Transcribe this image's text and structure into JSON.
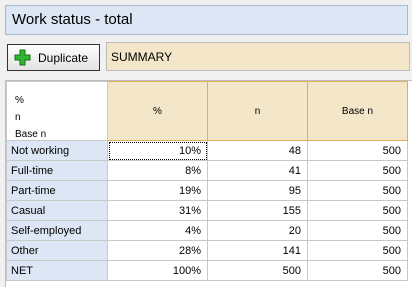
{
  "title": "Work status - total",
  "toolbar": {
    "duplicate_label": "Duplicate",
    "summary_value": "SUMMARY"
  },
  "icons": {
    "duplicate": "plus-icon"
  },
  "colors": {
    "plus": "#2fb62f",
    "header_fill": "#f3e6c9",
    "row_header_fill": "#dce6f4"
  },
  "table": {
    "corner_lines": [
      "%",
      "n",
      "Base n"
    ],
    "columns": [
      "%",
      "n",
      "Base n"
    ],
    "rows": [
      {
        "label": "Not working",
        "cells": [
          "10%",
          "48",
          "500"
        ]
      },
      {
        "label": "Full-time",
        "cells": [
          "8%",
          "41",
          "500"
        ]
      },
      {
        "label": "Part-time",
        "cells": [
          "19%",
          "95",
          "500"
        ]
      },
      {
        "label": "Casual",
        "cells": [
          "31%",
          "155",
          "500"
        ]
      },
      {
        "label": "Self-employed",
        "cells": [
          "4%",
          "20",
          "500"
        ]
      },
      {
        "label": "Other",
        "cells": [
          "28%",
          "141",
          "500"
        ]
      },
      {
        "label": "NET",
        "cells": [
          "100%",
          "500",
          "500"
        ]
      }
    ]
  }
}
